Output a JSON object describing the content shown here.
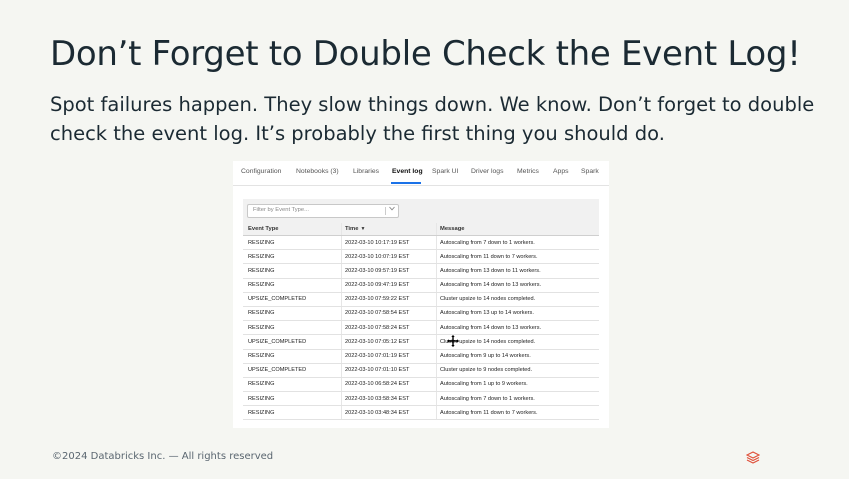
{
  "slide": {
    "title": "Don’t Forget to Double Check the Event Log!",
    "body": "Spot failures happen.  They slow things down.  We know.  Don’t forget to double check the event log.  It’s probably the first thing you should do."
  },
  "screenshot": {
    "tabs": [
      {
        "label": "Configuration",
        "active": false
      },
      {
        "label": "Notebooks (3)",
        "active": false
      },
      {
        "label": "Libraries",
        "active": false
      },
      {
        "label": "Event log",
        "active": true
      },
      {
        "label": "Spark UI",
        "active": false
      },
      {
        "label": "Driver logs",
        "active": false
      },
      {
        "label": "Metrics",
        "active": false
      },
      {
        "label": "Apps",
        "active": false
      },
      {
        "label": "Spark",
        "active": false
      }
    ],
    "filter": {
      "placeholder": "Filter by Event Type..."
    },
    "table": {
      "headers": {
        "event_type": "Event Type",
        "time": "Time",
        "message": "Message"
      },
      "rows": [
        {
          "event_type": "RESIZING",
          "time": "2022-03-10 10:17:19 EST",
          "message": "Autoscaling from 7 down to 1 workers."
        },
        {
          "event_type": "RESIZING",
          "time": "2022-03-10 10:07:19 EST",
          "message": "Autoscaling from 11 down to 7 workers."
        },
        {
          "event_type": "RESIZING",
          "time": "2022-03-10 09:57:19 EST",
          "message": "Autoscaling from 13 down to 11 workers."
        },
        {
          "event_type": "RESIZING",
          "time": "2022-03-10 09:47:19 EST",
          "message": "Autoscaling from 14 down to 13 workers."
        },
        {
          "event_type": "UPSIZE_COMPLETED",
          "time": "2022-03-10 07:59:22 EST",
          "message": "Cluster upsize to 14 nodes completed."
        },
        {
          "event_type": "RESIZING",
          "time": "2022-03-10 07:58:54 EST",
          "message": "Autoscaling from 13 up to 14 workers."
        },
        {
          "event_type": "RESIZING",
          "time": "2022-03-10 07:58:24 EST",
          "message": "Autoscaling from 14 down to 13 workers."
        },
        {
          "event_type": "UPSIZE_COMPLETED",
          "time": "2022-03-10 07:05:12 EST",
          "message": "Cluster upsize to 14 nodes completed."
        },
        {
          "event_type": "RESIZING",
          "time": "2022-03-10 07:01:19 EST",
          "message": "Autoscaling from 9 up to 14 workers."
        },
        {
          "event_type": "UPSIZE_COMPLETED",
          "time": "2022-03-10 07:01:10 EST",
          "message": "Cluster upsize to 9 nodes completed."
        },
        {
          "event_type": "RESIZING",
          "time": "2022-03-10 06:58:24 EST",
          "message": "Autoscaling from 1 up to 9 workers."
        },
        {
          "event_type": "RESIZING",
          "time": "2022-03-10 03:58:34 EST",
          "message": "Autoscaling from 7 down to 1 workers."
        },
        {
          "event_type": "RESIZING",
          "time": "2022-03-10 03:48:34 EST",
          "message": "Autoscaling from 11 down to 7 workers."
        }
      ]
    }
  },
  "footer": {
    "copyright": "©2024 Databricks Inc. — All rights reserved"
  },
  "icons": {
    "sort": "sort-descending-icon",
    "chevron": "chevron-down-icon",
    "logo": "databricks-logo-icon",
    "cursor": "move-cursor-icon"
  },
  "colors": {
    "background": "#f5f6f2",
    "title": "#1b2a33",
    "active_tab_underline": "#1b72e8",
    "logo": "#e0503a"
  }
}
